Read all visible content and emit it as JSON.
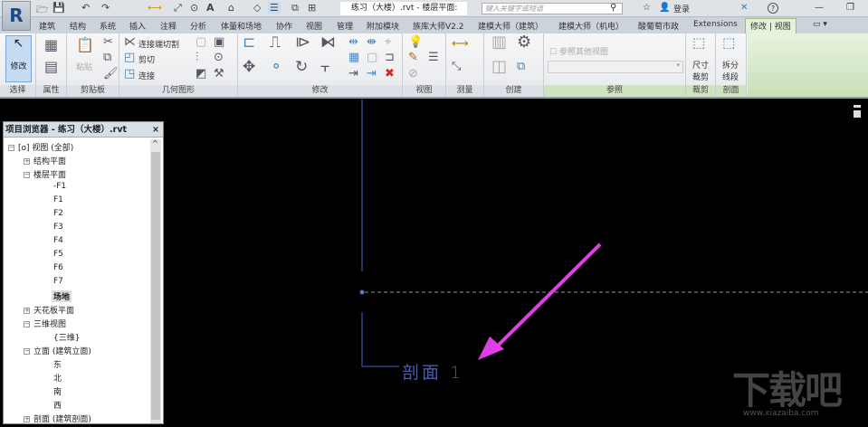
{
  "titlebar": {
    "document": "练习（大楼）.rvt - 楼层平面: ...",
    "search_placeholder": "键入关键字或短语",
    "login": "登录",
    "help": "?"
  },
  "tabs": [
    "建筑",
    "结构",
    "系统",
    "插入",
    "注释",
    "分析",
    "体量和场地",
    "协作",
    "视图",
    "管理",
    "附加模块",
    "族库大师V2.2",
    "建模大师（建筑）",
    "建模大师（机电）",
    "酸葡萄市政",
    "Extensions",
    "修改 | 视图"
  ],
  "ribbon": {
    "modify": "修改",
    "paste": "粘贴",
    "join_cut": "连接端切割",
    "cut": "剪切",
    "join": "连接",
    "ref_other_view": "参照其他视图",
    "size_crop": "尺寸\n裁剪",
    "split_segment": "拆分\n线段",
    "panels": [
      "选择",
      "属性",
      "剪贴板",
      "几何图形",
      "修改",
      "视图",
      "测量",
      "创建",
      "参照",
      "裁剪",
      "剖面"
    ]
  },
  "browser": {
    "title": "项目浏览器 - 练习（大楼）.rvt",
    "nodes": [
      {
        "label": "视图 (全部)"
      },
      {
        "label": "结构平面"
      },
      {
        "label": "楼层平面"
      },
      {
        "label": "-F1"
      },
      {
        "label": "F1"
      },
      {
        "label": "F2"
      },
      {
        "label": "F3"
      },
      {
        "label": "F4"
      },
      {
        "label": "F5"
      },
      {
        "label": "F6"
      },
      {
        "label": "F7"
      },
      {
        "label": "场地"
      },
      {
        "label": "天花板平面"
      },
      {
        "label": "三维视图"
      },
      {
        "label": "{三维}"
      },
      {
        "label": "立面 (建筑立面)"
      },
      {
        "label": "东"
      },
      {
        "label": "北"
      },
      {
        "label": "南"
      },
      {
        "label": "西"
      },
      {
        "label": "剖面 (建筑剖面)"
      }
    ]
  },
  "canvas": {
    "section_label": "剖面 1",
    "watermark": "下载吧",
    "watermark_url": "www.xiazaiba.com",
    "line_color": "#3a4d9a",
    "arrow_color": "#e23ee6"
  }
}
